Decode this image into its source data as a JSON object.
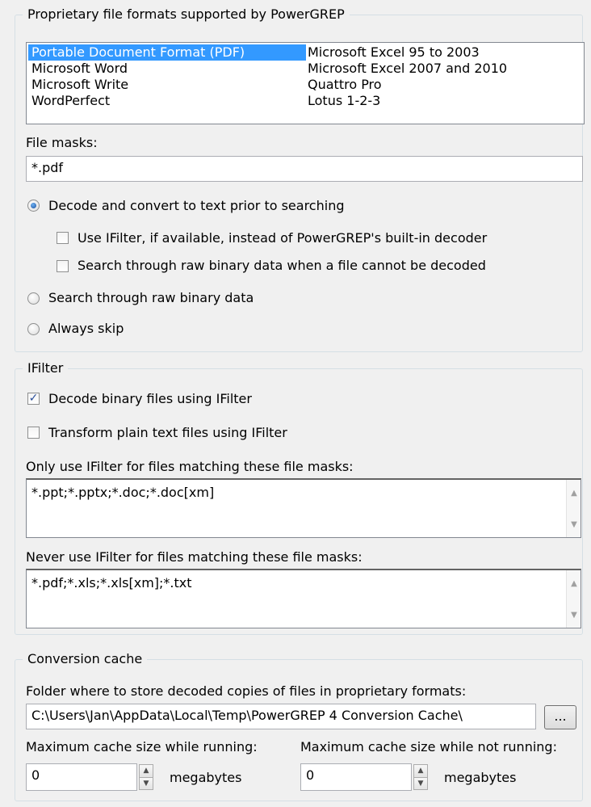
{
  "proprietary": {
    "legend": "Proprietary file formats supported by PowerGREP",
    "formats_col1": [
      "Portable Document Format (PDF)",
      "Microsoft Word",
      "Microsoft Write",
      "WordPerfect"
    ],
    "formats_col2": [
      "Microsoft Excel 95 to 2003",
      "Microsoft Excel 2007 and 2010",
      "Quattro Pro",
      "Lotus 1-2-3"
    ],
    "file_masks_label": "File masks:",
    "file_masks_value": "*.pdf",
    "decode_radio_label": "Decode and convert to text prior to searching",
    "use_ifilter_label": "Use IFilter, if available, instead of PowerGREP's built-in decoder",
    "search_raw_when_fail_label": "Search through raw binary data when a file cannot be decoded",
    "search_raw_radio_label": "Search through raw binary data",
    "always_skip_radio_label": "Always skip"
  },
  "ifilter": {
    "legend": "IFilter",
    "decode_binary_label": "Decode binary files using IFilter",
    "transform_plain_label": "Transform plain text files using IFilter",
    "only_use_label": "Only use IFilter for files matching these file masks:",
    "only_use_value": "*.ppt;*.pptx;*.doc;*.doc[xm]",
    "never_use_label": "Never use IFilter for files matching these file masks:",
    "never_use_value": "*.pdf;*.xls;*.xls[xm];*.txt"
  },
  "cache": {
    "legend": "Conversion cache",
    "folder_label": "Folder where to store decoded copies of files in proprietary formats:",
    "folder_value": "C:\\Users\\Jan\\AppData\\Local\\Temp\\PowerGREP 4 Conversion Cache\\",
    "browse_label": "...",
    "max_running_label": "Maximum cache size while running:",
    "max_running_value": "0",
    "max_not_running_label": "Maximum cache size while not running:",
    "max_not_running_value": "0",
    "unit_label": "megabytes"
  }
}
